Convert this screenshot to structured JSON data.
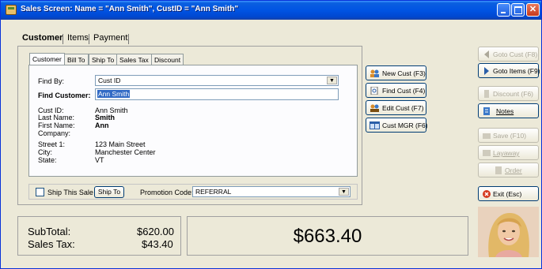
{
  "window": {
    "title": "Sales Screen: Name = \"Ann Smith\", CustID = \"Ann Smith\""
  },
  "main_tabs": [
    {
      "label": "Customer"
    },
    {
      "label": "Items"
    },
    {
      "label": "Payment"
    }
  ],
  "inner_tabs": [
    {
      "label": "Customer"
    },
    {
      "label": "Bill To"
    },
    {
      "label": "Ship To"
    },
    {
      "label": "Sales Tax"
    },
    {
      "label": "Discount"
    }
  ],
  "find": {
    "find_by_label": "Find By:",
    "find_by_value": "Cust ID",
    "find_customer_label": "Find Customer:",
    "find_customer_value": "Ann Smith"
  },
  "customer": {
    "fields": [
      {
        "label": "Cust ID:",
        "value": "Ann Smith",
        "bold": false
      },
      {
        "label": "Last Name:",
        "value": "Smith",
        "bold": true
      },
      {
        "label": "First Name:",
        "value": "Ann",
        "bold": true
      },
      {
        "label": "Company:",
        "value": "",
        "bold": false
      },
      {
        "label": "Street 1:",
        "value": "123 Main Street",
        "bold": false
      },
      {
        "label": "City:",
        "value": "Manchester Center",
        "bold": false
      },
      {
        "label": "State:",
        "value": "VT",
        "bold": false
      }
    ]
  },
  "cust_buttons": [
    {
      "label": "New Cust (F3)"
    },
    {
      "label": "Find Cust (F4)"
    },
    {
      "label": "Edit Cust (F7)"
    },
    {
      "label": "Cust MGR (F6)"
    }
  ],
  "ship": {
    "ship_this_sale": "Ship This Sale",
    "ship_to_button": "Ship To",
    "promotion_code_label": "Promotion Code:",
    "promotion_code_value": "REFERRAL"
  },
  "right_buttons": [
    {
      "label": "Goto Cust (F8)"
    },
    {
      "label": "Goto Items (F9)"
    },
    {
      "label": "Discount (F6)"
    },
    {
      "label": "Notes"
    },
    {
      "label": "Save (F10)"
    },
    {
      "label": "Layaway"
    },
    {
      "label": "Order"
    },
    {
      "label": "Exit (Esc)"
    }
  ],
  "totals": {
    "subtotal_label": "SubTotal:",
    "subtotal_value": "$620.00",
    "sales_tax_label": "Sales Tax:",
    "sales_tax_value": "$43.40",
    "grand_total": "$663.40"
  },
  "colors": {
    "title_bar": "#0054e3",
    "accent_blue": "#316ac5",
    "window_bg": "#ece9d8"
  }
}
